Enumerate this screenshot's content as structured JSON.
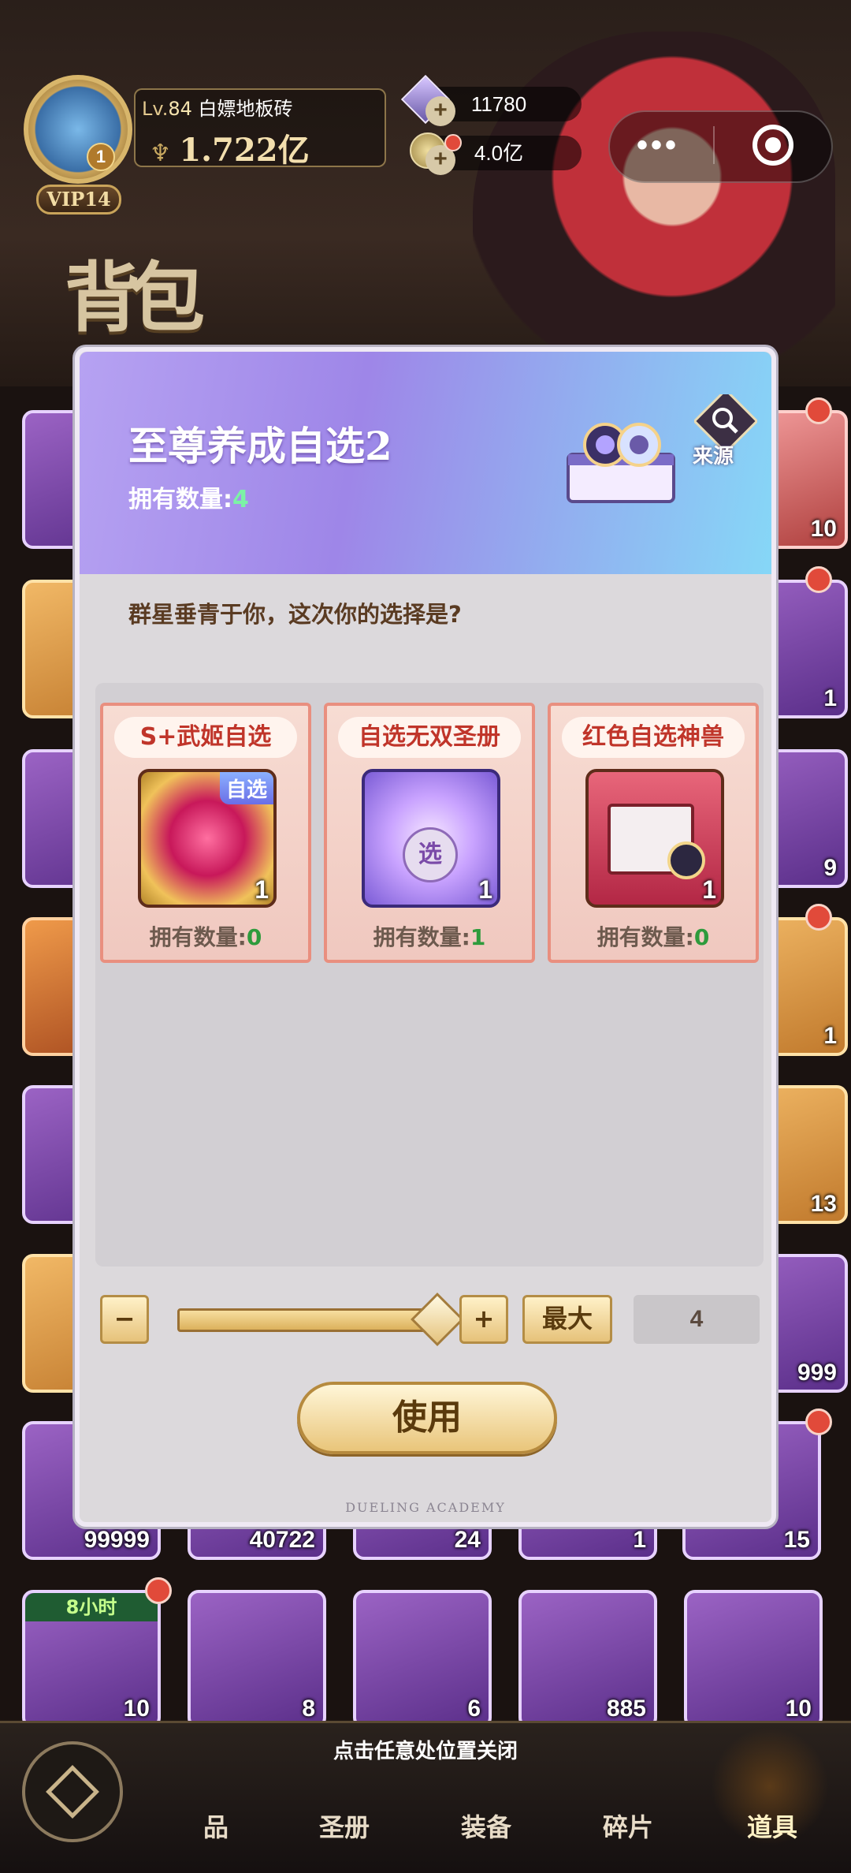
{
  "header": {
    "level_prefix": "Lv.",
    "level": "84",
    "player_name": "白嫖地板砖",
    "power": "1.722亿",
    "vip": "VIP14",
    "avatar_badge": "1",
    "diamonds": "11780",
    "gold": "4.0亿",
    "bag_title": "背包"
  },
  "modal": {
    "title": "至尊养成自选2",
    "owned_label": "拥有数量:",
    "owned_value": "4",
    "source_label": "来源",
    "prompt": "群星垂青于你，这次你的选择是?",
    "choices": [
      {
        "name": "S+武姬自选",
        "tag": "自选",
        "count": "1",
        "owned_label": "拥有数量:",
        "owned": "0"
      },
      {
        "name": "自选无双圣册",
        "tag": "选",
        "count": "1",
        "owned_label": "拥有数量:",
        "owned": "1"
      },
      {
        "name": "红色自选神兽",
        "count": "1",
        "owned_label": "拥有数量:",
        "owned": "0"
      }
    ],
    "minus": "−",
    "plus": "+",
    "max_label": "最大",
    "quantity": "4",
    "slider_fraction": 1.0,
    "use_label": "使用",
    "footer": "DUELING ACADEMY"
  },
  "bag": {
    "visible_counts": [
      "10",
      "1",
      "9",
      "1",
      "13",
      "999",
      "15",
      "99999",
      "40722",
      "24",
      "1",
      "10",
      "8",
      "6",
      "885",
      "10"
    ],
    "timer": "8小时"
  },
  "nav": {
    "close_hint": "点击任意处位置关闭",
    "items": [
      "品",
      "圣册",
      "装备",
      "碎片",
      "道具"
    ]
  },
  "colors": {
    "accent_gold": "#e6c27a",
    "header_gradient_start": "#b6a2f2",
    "header_gradient_end": "#86d7f7",
    "owned_green": "#2e9b3c",
    "name_red": "#c0352a"
  }
}
